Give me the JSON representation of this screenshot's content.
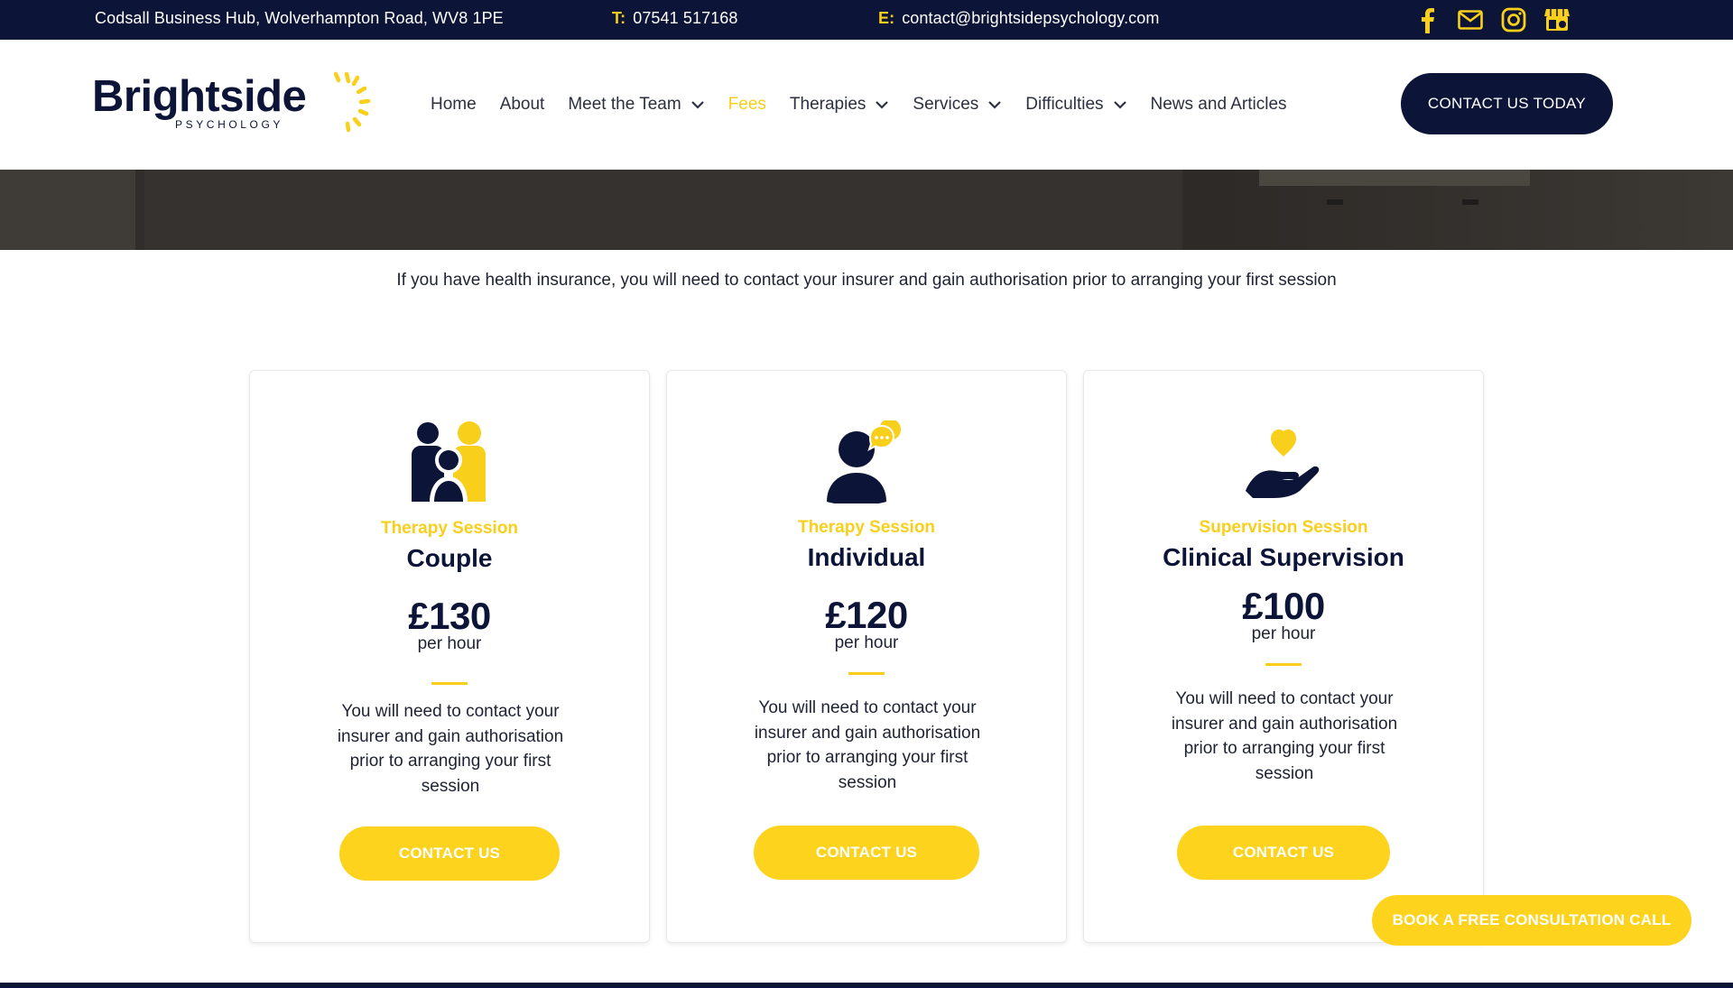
{
  "topbar": {
    "address": "Codsall Business Hub, Wolverhampton Road, WV8 1PE",
    "phone_label": "T:",
    "phone": "07541 517168",
    "email_label": "E:",
    "email": "contact@brightsidepsychology.com",
    "icons": [
      "facebook-icon",
      "mail-icon",
      "instagram-icon",
      "google-business-icon"
    ]
  },
  "brand": {
    "name": "Brightside",
    "tagline": "PSYCHOLOGY",
    "colors": {
      "navy": "#0c1437",
      "yellow": "#f8cf1b"
    }
  },
  "nav": {
    "items": [
      {
        "label": "Home",
        "has_dropdown": false,
        "active": false
      },
      {
        "label": "About",
        "has_dropdown": false,
        "active": false
      },
      {
        "label": "Meet the Team",
        "has_dropdown": true,
        "active": false
      },
      {
        "label": "Fees",
        "has_dropdown": false,
        "active": true
      },
      {
        "label": "Therapies",
        "has_dropdown": true,
        "active": false
      },
      {
        "label": "Services",
        "has_dropdown": true,
        "active": false
      },
      {
        "label": "Difficulties",
        "has_dropdown": true,
        "active": false
      },
      {
        "label": "News and Articles",
        "has_dropdown": false,
        "active": false
      }
    ],
    "cta": "CONTACT US TODAY"
  },
  "intro": "If you have health insurance, you will need to contact your insurer and gain authorisation prior to arranging your first session",
  "cards": [
    {
      "icon": "couple-icon",
      "kicker": "Therapy Session",
      "title": "Couple",
      "price": "£130",
      "unit": "per hour",
      "desc_lines": [
        "You will need to contact your",
        "insurer and gain authorisation",
        "prior to arranging your first",
        "session"
      ],
      "button": "CONTACT US"
    },
    {
      "icon": "individual-chat-icon",
      "kicker": "Therapy Session",
      "title": "Individual",
      "price": "£120",
      "unit": "per hour",
      "desc_lines": [
        "You will need to contact your",
        "insurer and gain authorisation",
        "prior to arranging your first",
        "session"
      ],
      "button": "CONTACT US"
    },
    {
      "icon": "heart-hand-icon",
      "kicker": "Supervision Session",
      "title": "Clinical Supervision",
      "price": "£100",
      "unit": "per hour",
      "desc_lines": [
        "You will need to contact your",
        "insurer and gain authorisation",
        "prior to arranging your first",
        "session"
      ],
      "button": "CONTACT US"
    }
  ],
  "floating_button": "BOOK A FREE CONSULTATION CALL"
}
